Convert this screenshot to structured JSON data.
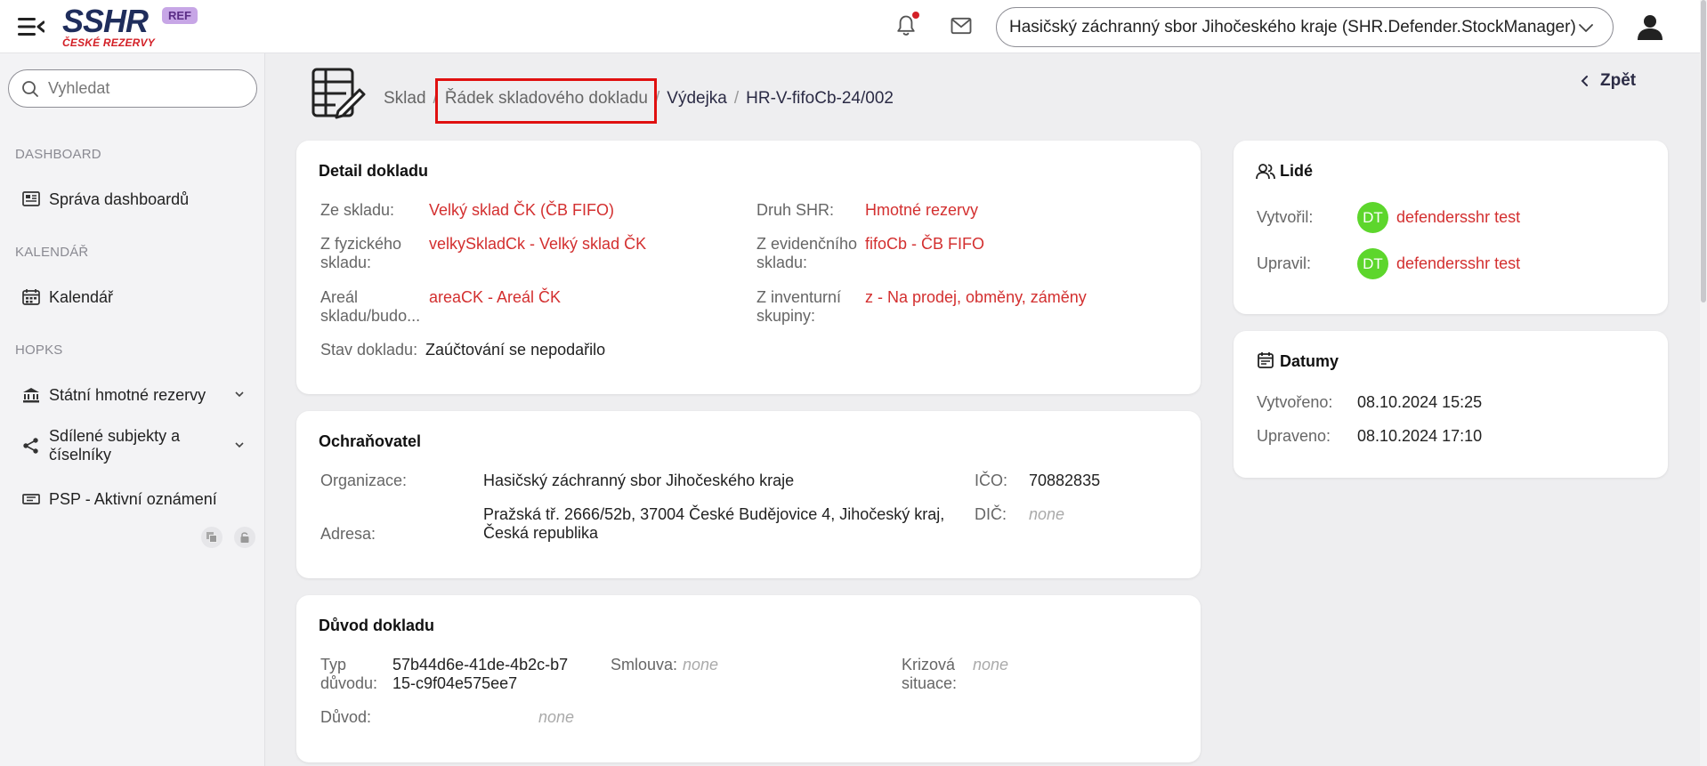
{
  "header": {
    "logo_text": "SSHR",
    "logo_sub": "ČESKÉ REZERVY",
    "env_badge": "REF",
    "organization": "Hasičský záchranný sbor Jihočeského kraje (SHR.Defender.StockManager)"
  },
  "sidebar": {
    "search_placeholder": "Vyhledat",
    "sections": [
      {
        "title": "DASHBOARD",
        "items": [
          {
            "label": "Správa dashboardů",
            "icon": "dashboard-icon"
          }
        ]
      },
      {
        "title": "KALENDÁŘ",
        "items": [
          {
            "label": "Kalendář",
            "icon": "calendar-icon"
          }
        ]
      },
      {
        "title": "HOPKS",
        "items": [
          {
            "label": "Státní hmotné rezervy",
            "icon": "bank-icon"
          },
          {
            "label": "Sdílené subjekty a číselníky",
            "icon": "share-icon"
          },
          {
            "label": "PSP - Aktivní oznámení",
            "icon": "ticket-icon"
          }
        ]
      }
    ]
  },
  "breadcrumb": {
    "items": [
      "Sklad",
      "Řádek skladového dokladu",
      "Výdejka",
      "HR-V-fifoCb-24/002"
    ],
    "separator": "/"
  },
  "back_label": "Zpět",
  "detail": {
    "title": "Detail dokladu",
    "from_warehouse_label": "Ze skladu:",
    "from_warehouse": "Velký sklad ČK (ČB FIFO)",
    "shr_type_label": "Druh SHR:",
    "shr_type": "Hmotné rezervy",
    "physical_warehouse_label": "Z fyzického skladu:",
    "physical_warehouse": "velkySkladCk - Velký sklad ČK",
    "records_warehouse_label": "Z evidenčního skladu:",
    "records_warehouse": "fifoCb - ČB FIFO",
    "area_label": "Areál skladu/budo...",
    "area": "areaCK - Areál ČK",
    "inventory_group_label": "Z inventurní skupiny:",
    "inventory_group": "z - Na prodej, obměny, záměny",
    "status_label": "Stav dokladu:",
    "status": "Zaúčtování se nepodařilo"
  },
  "protector": {
    "title": "Ochraňovatel",
    "org_label": "Organizace:",
    "org": "Hasičský záchranný sbor Jihočeského kraje",
    "ico_label": "IČO:",
    "ico": "70882835",
    "address_label": "Adresa:",
    "address": "Pražská tř. 2666/52b, 37004 České Budějovice 4, Jihočeský kraj, Česká republika",
    "dic_label": "DIČ:",
    "dic": "none"
  },
  "reason": {
    "title": "Důvod dokladu",
    "type_label": "Typ důvodu:",
    "type": "57b44d6e-41de-4b2c-b715-c9f04e575ee7",
    "contract_label": "Smlouva:",
    "contract": "none",
    "crisis_label": "Krizová situace:",
    "crisis": "none",
    "reason_label": "Důvod:",
    "reason": "none"
  },
  "people": {
    "title": "Lidé",
    "created_by_label": "Vytvořil:",
    "created_by_initials": "DT",
    "created_by": "defendersshr test",
    "modified_by_label": "Upravil:",
    "modified_by_initials": "DT",
    "modified_by": "defendersshr test"
  },
  "dates": {
    "title": "Datumy",
    "created_label": "Vytvořeno:",
    "created": "08.10.2024 15:25",
    "modified_label": "Upraveno:",
    "modified": "08.10.2024 17:10"
  },
  "colors": {
    "accent_red": "#d32f2f",
    "brand_navy": "#1f2d5c",
    "avatar_green": "#5dd62c",
    "highlight": "#e01010"
  }
}
